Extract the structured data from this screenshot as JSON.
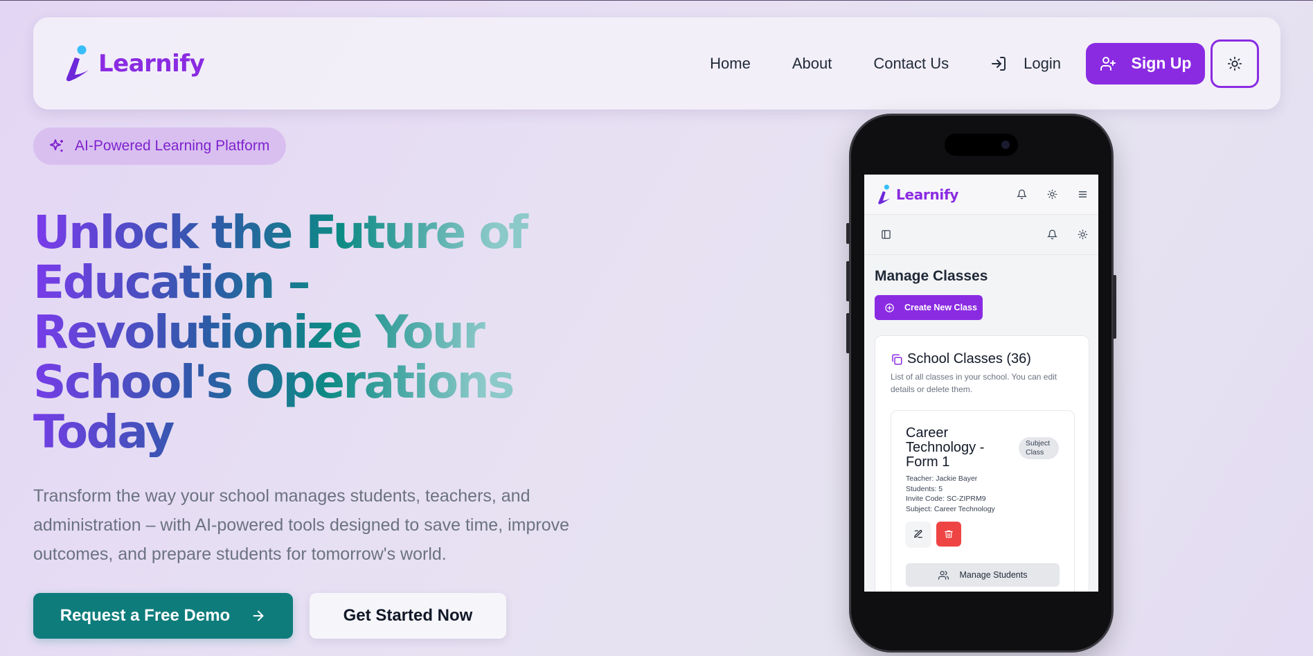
{
  "navbar": {
    "brand": "Learnify",
    "links": [
      "Home",
      "About",
      "Contact Us"
    ],
    "login_label": "Login",
    "signup_label": "Sign Up",
    "theme_icon": "sun-icon"
  },
  "hero": {
    "pill_label": "AI-Powered Learning Platform",
    "headline_lines": [
      "Unlock the Future of",
      "Education –",
      "Revolutionize Your",
      "School's Operations",
      "Today"
    ],
    "subtext": "Transform the way your school manages students, teachers, and administration – with AI-powered tools designed to save time, improve outcomes, and prepare students for tomorrow's world.",
    "primary_button": "Request a Free Demo",
    "secondary_button": "Get Started Now"
  },
  "phone": {
    "brand": "Learnify",
    "page_title": "Manage Classes",
    "create_button": "Create New Class",
    "card": {
      "title": "School Classes (36)",
      "description": "List of all classes in your school. You can edit details or delete them.",
      "class_item": {
        "name": "Career Technology - Form 1",
        "badge": "Subject Class",
        "teacher": "Teacher: Jackie Bayer",
        "students": "Students: 5",
        "invite_code": "Invite Code: SC-ZIPRM9",
        "subject": "Subject: Career Technology",
        "manage_button": "Manage Students"
      }
    }
  },
  "colors": {
    "brand_purple": "#8a2be2",
    "teal": "#0f7c7c",
    "danger": "#ef4444"
  }
}
